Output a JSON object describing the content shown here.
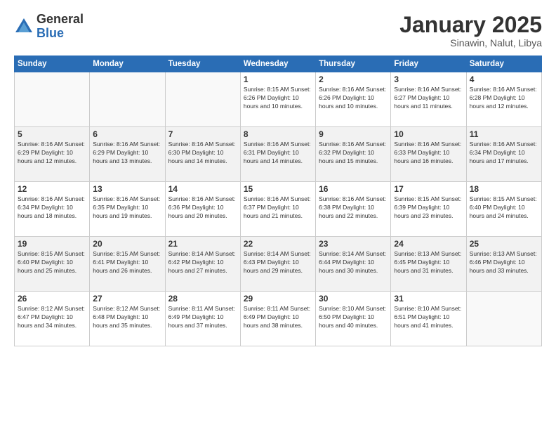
{
  "logo": {
    "general": "General",
    "blue": "Blue"
  },
  "title": "January 2025",
  "subtitle": "Sinawin, Nalut, Libya",
  "days_of_week": [
    "Sunday",
    "Monday",
    "Tuesday",
    "Wednesday",
    "Thursday",
    "Friday",
    "Saturday"
  ],
  "weeks": [
    [
      {
        "day": "",
        "info": ""
      },
      {
        "day": "",
        "info": ""
      },
      {
        "day": "",
        "info": ""
      },
      {
        "day": "1",
        "info": "Sunrise: 8:15 AM\nSunset: 6:26 PM\nDaylight: 10 hours and 10 minutes."
      },
      {
        "day": "2",
        "info": "Sunrise: 8:16 AM\nSunset: 6:26 PM\nDaylight: 10 hours and 10 minutes."
      },
      {
        "day": "3",
        "info": "Sunrise: 8:16 AM\nSunset: 6:27 PM\nDaylight: 10 hours and 11 minutes."
      },
      {
        "day": "4",
        "info": "Sunrise: 8:16 AM\nSunset: 6:28 PM\nDaylight: 10 hours and 12 minutes."
      }
    ],
    [
      {
        "day": "5",
        "info": "Sunrise: 8:16 AM\nSunset: 6:29 PM\nDaylight: 10 hours and 12 minutes."
      },
      {
        "day": "6",
        "info": "Sunrise: 8:16 AM\nSunset: 6:29 PM\nDaylight: 10 hours and 13 minutes."
      },
      {
        "day": "7",
        "info": "Sunrise: 8:16 AM\nSunset: 6:30 PM\nDaylight: 10 hours and 14 minutes."
      },
      {
        "day": "8",
        "info": "Sunrise: 8:16 AM\nSunset: 6:31 PM\nDaylight: 10 hours and 14 minutes."
      },
      {
        "day": "9",
        "info": "Sunrise: 8:16 AM\nSunset: 6:32 PM\nDaylight: 10 hours and 15 minutes."
      },
      {
        "day": "10",
        "info": "Sunrise: 8:16 AM\nSunset: 6:33 PM\nDaylight: 10 hours and 16 minutes."
      },
      {
        "day": "11",
        "info": "Sunrise: 8:16 AM\nSunset: 6:34 PM\nDaylight: 10 hours and 17 minutes."
      }
    ],
    [
      {
        "day": "12",
        "info": "Sunrise: 8:16 AM\nSunset: 6:34 PM\nDaylight: 10 hours and 18 minutes."
      },
      {
        "day": "13",
        "info": "Sunrise: 8:16 AM\nSunset: 6:35 PM\nDaylight: 10 hours and 19 minutes."
      },
      {
        "day": "14",
        "info": "Sunrise: 8:16 AM\nSunset: 6:36 PM\nDaylight: 10 hours and 20 minutes."
      },
      {
        "day": "15",
        "info": "Sunrise: 8:16 AM\nSunset: 6:37 PM\nDaylight: 10 hours and 21 minutes."
      },
      {
        "day": "16",
        "info": "Sunrise: 8:16 AM\nSunset: 6:38 PM\nDaylight: 10 hours and 22 minutes."
      },
      {
        "day": "17",
        "info": "Sunrise: 8:15 AM\nSunset: 6:39 PM\nDaylight: 10 hours and 23 minutes."
      },
      {
        "day": "18",
        "info": "Sunrise: 8:15 AM\nSunset: 6:40 PM\nDaylight: 10 hours and 24 minutes."
      }
    ],
    [
      {
        "day": "19",
        "info": "Sunrise: 8:15 AM\nSunset: 6:40 PM\nDaylight: 10 hours and 25 minutes."
      },
      {
        "day": "20",
        "info": "Sunrise: 8:15 AM\nSunset: 6:41 PM\nDaylight: 10 hours and 26 minutes."
      },
      {
        "day": "21",
        "info": "Sunrise: 8:14 AM\nSunset: 6:42 PM\nDaylight: 10 hours and 27 minutes."
      },
      {
        "day": "22",
        "info": "Sunrise: 8:14 AM\nSunset: 6:43 PM\nDaylight: 10 hours and 29 minutes."
      },
      {
        "day": "23",
        "info": "Sunrise: 8:14 AM\nSunset: 6:44 PM\nDaylight: 10 hours and 30 minutes."
      },
      {
        "day": "24",
        "info": "Sunrise: 8:13 AM\nSunset: 6:45 PM\nDaylight: 10 hours and 31 minutes."
      },
      {
        "day": "25",
        "info": "Sunrise: 8:13 AM\nSunset: 6:46 PM\nDaylight: 10 hours and 33 minutes."
      }
    ],
    [
      {
        "day": "26",
        "info": "Sunrise: 8:12 AM\nSunset: 6:47 PM\nDaylight: 10 hours and 34 minutes."
      },
      {
        "day": "27",
        "info": "Sunrise: 8:12 AM\nSunset: 6:48 PM\nDaylight: 10 hours and 35 minutes."
      },
      {
        "day": "28",
        "info": "Sunrise: 8:11 AM\nSunset: 6:49 PM\nDaylight: 10 hours and 37 minutes."
      },
      {
        "day": "29",
        "info": "Sunrise: 8:11 AM\nSunset: 6:49 PM\nDaylight: 10 hours and 38 minutes."
      },
      {
        "day": "30",
        "info": "Sunrise: 8:10 AM\nSunset: 6:50 PM\nDaylight: 10 hours and 40 minutes."
      },
      {
        "day": "31",
        "info": "Sunrise: 8:10 AM\nSunset: 6:51 PM\nDaylight: 10 hours and 41 minutes."
      },
      {
        "day": "",
        "info": ""
      }
    ]
  ]
}
